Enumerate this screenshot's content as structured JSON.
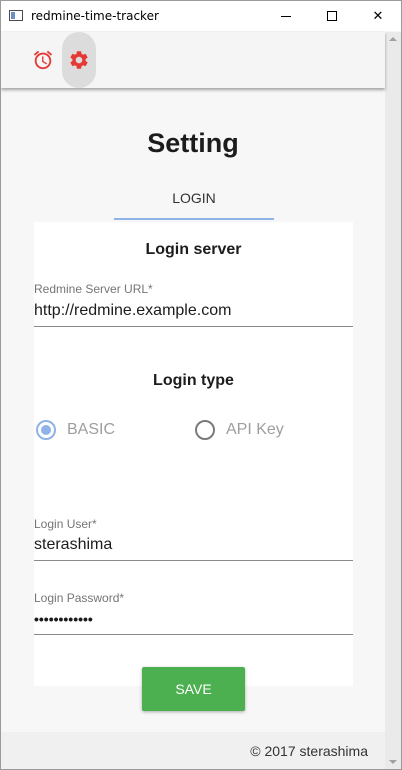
{
  "window": {
    "title": "redmine-time-tracker",
    "minimize_symbol": "",
    "maximize_symbol": "",
    "close_symbol": "✕"
  },
  "toolbar": {
    "icons": [
      "alarm-clock-icon",
      "gear-icon"
    ],
    "accent_color": "#e53935"
  },
  "page": {
    "title": "Setting",
    "tabs": [
      {
        "label": "LOGIN",
        "active": true
      }
    ]
  },
  "login_server": {
    "heading": "Login server",
    "url_label": "Redmine Server URL*",
    "url_value": "http://redmine.example.com"
  },
  "login_type": {
    "heading": "Login type",
    "options": [
      {
        "label": "BASIC",
        "checked": true
      },
      {
        "label": "API Key",
        "checked": false
      }
    ]
  },
  "credentials": {
    "user_label": "Login User*",
    "user_value": "sterashima",
    "password_label": "Login Password*",
    "password_value": "••••••••••••"
  },
  "actions": {
    "save_label": "SAVE",
    "save_color": "#4caf50"
  },
  "footer": {
    "text": "© 2017 sterashima"
  }
}
